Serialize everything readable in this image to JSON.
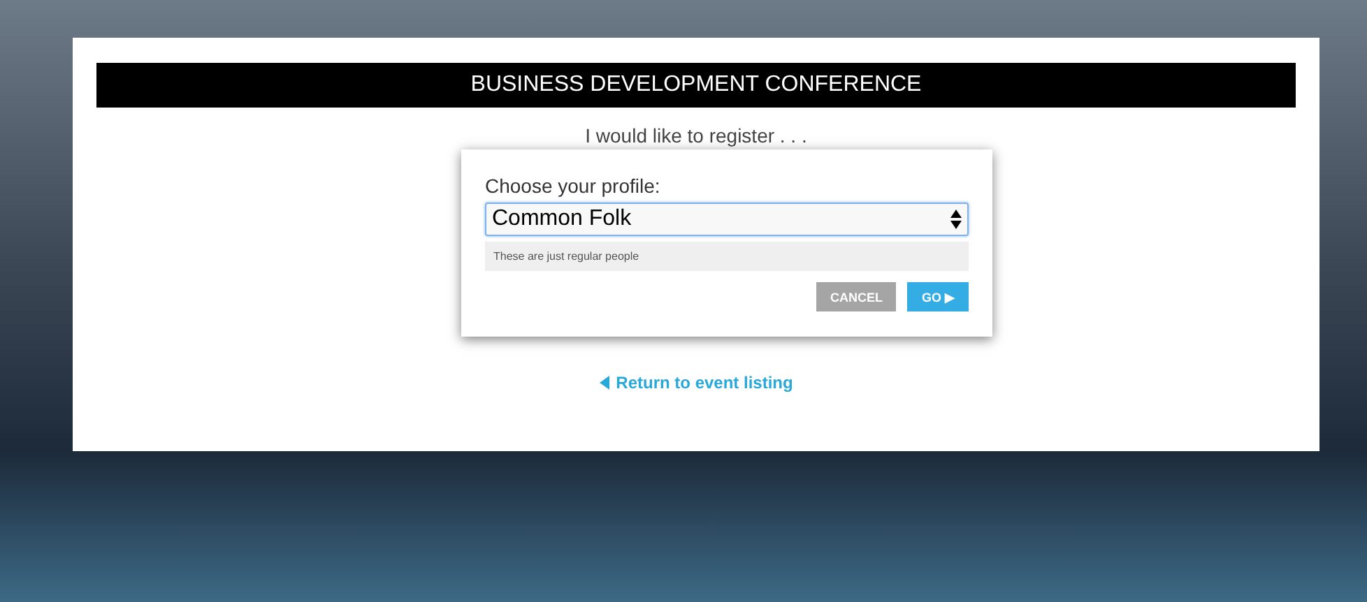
{
  "header": {
    "title": "BUSINESS DEVELOPMENT CONFERENCE"
  },
  "prompt": "I would like to register . . .",
  "dialog": {
    "label": "Choose your profile:",
    "select_value": "Common Folk",
    "description": "These are just regular people",
    "buttons": [
      {
        "label": "CANCEL",
        "kind": "secondary"
      },
      {
        "label": "GO ▶",
        "kind": "primary"
      }
    ]
  },
  "back_link": "Return to event listing"
}
